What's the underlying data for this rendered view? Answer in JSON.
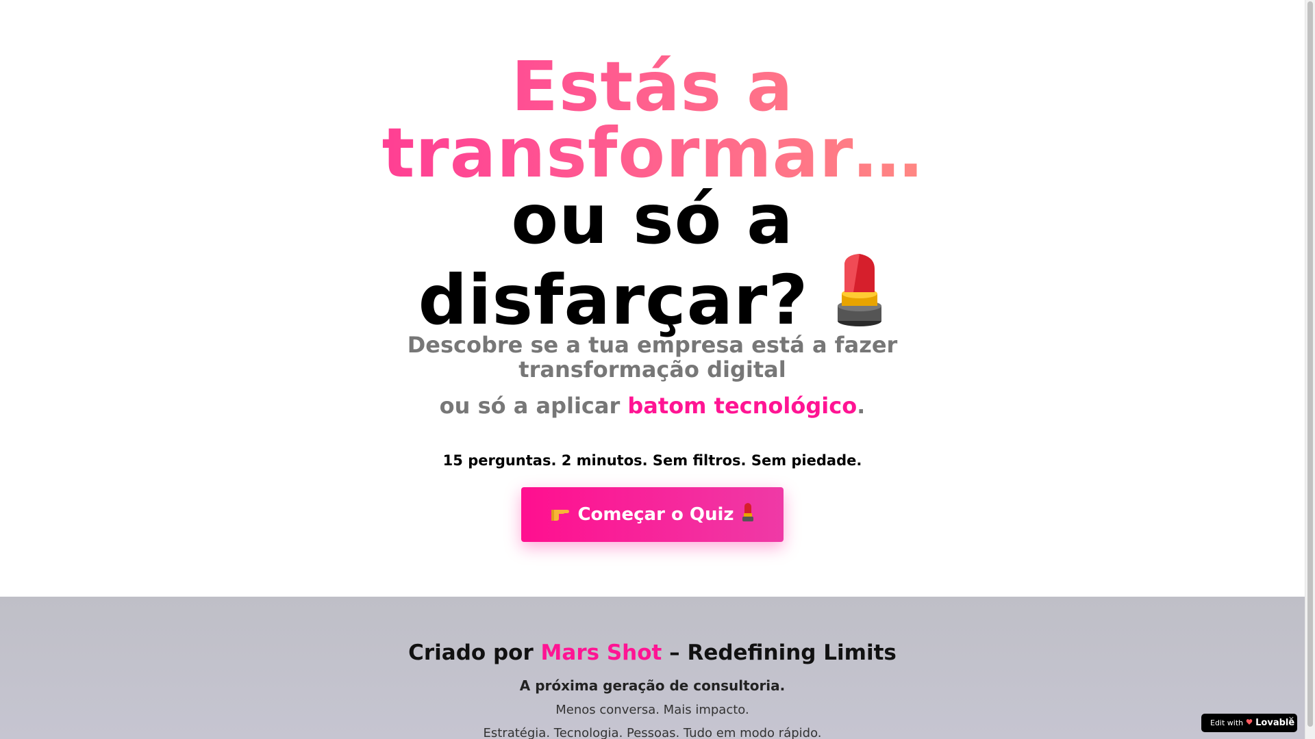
{
  "hero": {
    "headline_line1": "Estás a",
    "headline_line2": "transformar…",
    "headline_line3": "ou só a",
    "headline_line4": "disfarçar?",
    "sub_line1": "Descobre se a tua empresa está a fazer",
    "sub_line2": "transformação digital",
    "sub2_prefix": "ou só a aplicar",
    "sub2_highlight": "batom tecnológico",
    "sub2_suffix": ".",
    "tagline": "15 perguntas. 2 minutos. Sem filtros. Sem piedade."
  },
  "cta": {
    "label": "Começar o Quiz"
  },
  "footer": {
    "credit_prefix": "Criado por",
    "credit_brand": "Mars Shot",
    "credit_suffix": "– Redefining Limits",
    "next_gen": "A próxima geração de consultoria.",
    "less_talk": "Menos conversa. Mais impacto.",
    "strategy": "Estratégia. Tecnologia. Pessoas. Tudo em modo rápido."
  },
  "badge": {
    "prefix": "Edit with",
    "brand": "Lovable",
    "close": "×"
  },
  "icons": [
    "lipstick-icon",
    "pointing-hand-icon",
    "lovable-heart-icon",
    "close-icon"
  ],
  "colors": {
    "accent": "#ff1493",
    "gradient_end": "#ffd27a",
    "footer_bg": "#c2c1cc"
  }
}
